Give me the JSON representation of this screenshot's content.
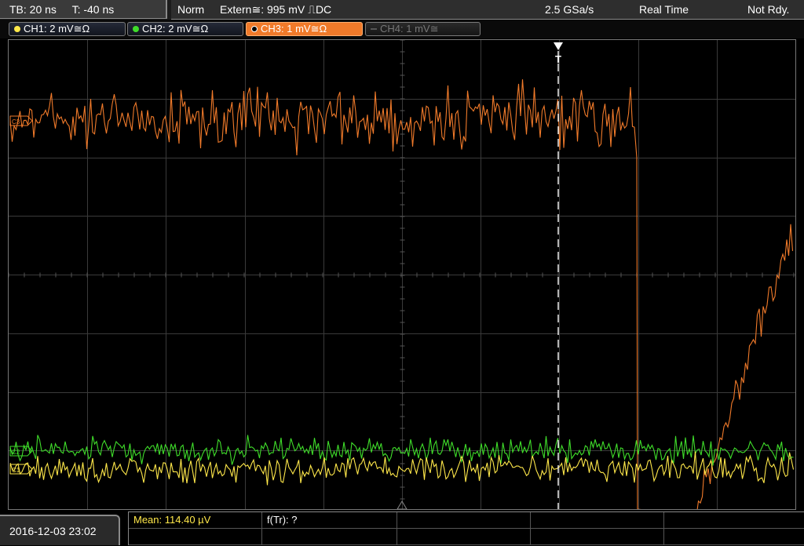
{
  "status_bar": {
    "timebase": "TB: 20 ns",
    "trigger_offset": "T: -40 ns",
    "mode": "Norm",
    "trigger_source": "Extern",
    "trigger_level": "995 mV",
    "trigger_coupling": "DC",
    "sample_rate": "2.5 GSa/s",
    "acquisition": "Real Time",
    "state": "Not Rdy."
  },
  "channels": [
    {
      "label": "CH1: 2 mV",
      "color": "#ffe84a",
      "active": false,
      "enabled": true
    },
    {
      "label": "CH2: 2 mV",
      "color": "#3fdd2a",
      "active": false,
      "enabled": true
    },
    {
      "label": "CH3: 1 mV",
      "color": "#f07a2a",
      "active": true,
      "enabled": true
    },
    {
      "label": "CH4: 1 mV",
      "color": "#777777",
      "active": false,
      "enabled": false
    }
  ],
  "channel_suffix": "≅Ω",
  "ch4_suffix": "≅",
  "trigger_marker": "T",
  "footer": {
    "datetime": "2016-12-03 23:02",
    "mean_label": "Mean:",
    "mean_value": "114.40 µV",
    "freq_label": "f(Tr):",
    "freq_value": "?"
  }
}
